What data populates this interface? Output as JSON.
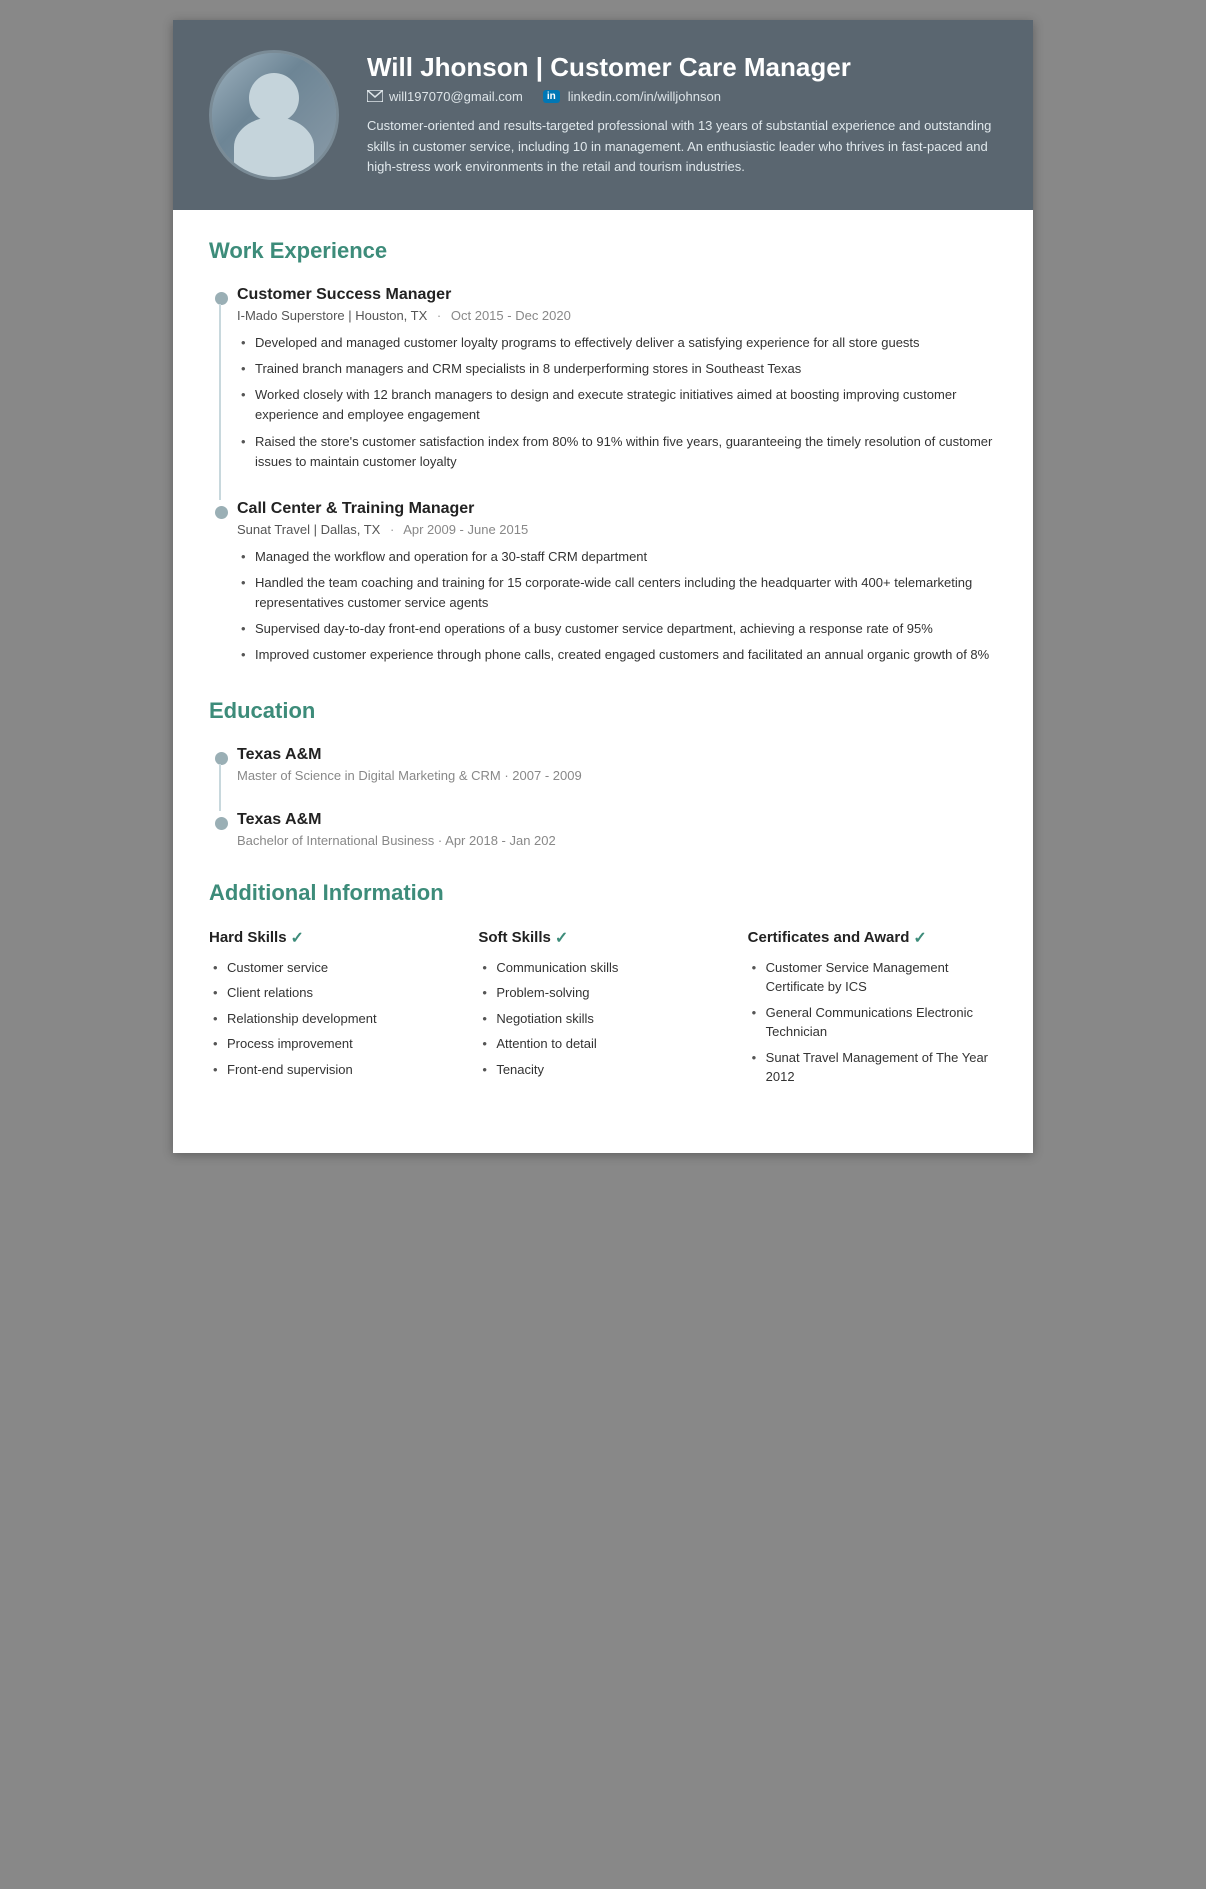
{
  "header": {
    "name": "Will Jhonson",
    "title": "Customer Care Manager",
    "email": "will197070@gmail.com",
    "linkedin_label": "in",
    "linkedin": "linkedin.com/in/willjohnson",
    "summary": "Customer-oriented and results-targeted professional with 13 years of substantial experience and outstanding skills in customer service, including 10 in management. An enthusiastic leader who thrives in fast-paced and high-stress work environments in the retail and tourism industries."
  },
  "sections": {
    "work_experience": {
      "title": "Work Experience",
      "jobs": [
        {
          "title": "Customer Success Manager",
          "company": "I-Mado Superstore | Houston, TX",
          "dates": "Oct 2015 - Dec 2020",
          "bullets": [
            "Developed and managed customer loyalty programs to effectively deliver a satisfying experience for all store guests",
            "Trained branch managers and CRM specialists in 8 underperforming stores in Southeast Texas",
            "Worked closely with 12 branch managers to design and execute strategic initiatives aimed at boosting improving customer experience and employee engagement",
            "Raised the store's customer satisfaction index from 80% to 91% within five years, guaranteeing the timely resolution of customer issues to maintain customer loyalty"
          ]
        },
        {
          "title": "Call Center & Training Manager",
          "company": "Sunat Travel | Dallas, TX",
          "dates": "Apr 2009  - June 2015",
          "bullets": [
            "Managed the workflow and operation for a 30-staff CRM department",
            "Handled the team coaching and training for 15 corporate-wide call centers including the headquarter with 400+ telemarketing representatives customer service agents",
            "Supervised day-to-day front-end operations of a busy customer service department, achieving a response rate of 95%",
            "Improved customer experience through phone calls, created engaged customers and facilitated an annual organic growth of 8%"
          ]
        }
      ]
    },
    "education": {
      "title": "Education",
      "items": [
        {
          "institution": "Texas A&M",
          "degree": "Master of Science in Digital Marketing & CRM",
          "dates": "2007 - 2009"
        },
        {
          "institution": "Texas A&M",
          "degree": "Bachelor of International Business",
          "dates": "Apr 2018 - Jan 202"
        }
      ]
    },
    "additional": {
      "title": "Additional Information",
      "hard_skills": {
        "heading": "Hard Skills",
        "items": [
          "Customer service",
          "Client relations",
          "Relationship development",
          "Process improvement",
          "Front-end supervision"
        ]
      },
      "soft_skills": {
        "heading": "Soft Skills",
        "items": [
          "Communication skills",
          "Problem-solving",
          "Negotiation skills",
          "Attention to detail",
          "Tenacity"
        ]
      },
      "certificates": {
        "heading": "Certificates and Award",
        "items": [
          "Customer Service Management Certificate by ICS",
          "General Communications Electronic Technician",
          "Sunat Travel Management of The Year 2012"
        ]
      }
    }
  }
}
